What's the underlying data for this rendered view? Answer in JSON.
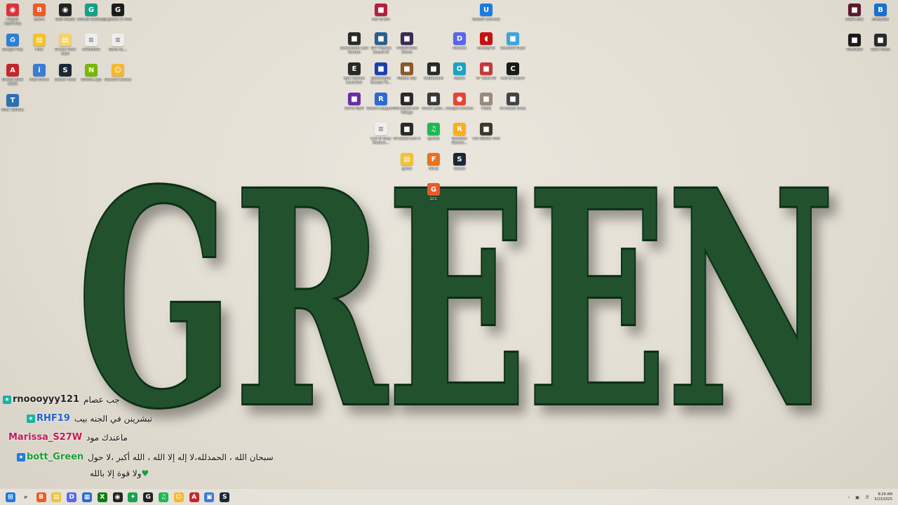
{
  "wallpaper": {
    "word": "GREEN",
    "color": "#21512e"
  },
  "desktop_icons": [
    {
      "label": "Project Lightning",
      "icon": "red-circle-icon",
      "color": "#d8343b"
    },
    {
      "label": "Brave",
      "icon": "brave-icon",
      "color": "#f05a24"
    },
    {
      "label": "OBS Studio",
      "icon": "obs-icon",
      "color": "#222222"
    },
    {
      "label": "GitHub Desktop",
      "icon": "github-icon",
      "color": "#16a085"
    },
    {
      "label": "Logitech G HUB",
      "icon": "logitech-icon",
      "color": "#1b1b1b"
    },
    {
      "label": "Google Play",
      "icon": "recycle-icon",
      "color": "#2c7fd1"
    },
    {
      "label": "Files",
      "icon": "folder-icon",
      "color": "#f2c230"
    },
    {
      "label": "Grand Theft Auto",
      "icon": "folder-icon",
      "color": "#f5d36a"
    },
    {
      "label": "DIVIDEWA",
      "icon": "document-icon",
      "color": "#eeeeee"
    },
    {
      "label": "NEUE EL...",
      "icon": "document-icon",
      "color": "#eeeeee"
    },
    {
      "label": "Dream Rock ASUS",
      "icon": "asus-icon",
      "color": "#c4262e"
    },
    {
      "label": "Intel Driver",
      "icon": "intel-icon",
      "color": "#3a7bd5"
    },
    {
      "label": "Steam Tools",
      "icon": "steam-icon",
      "color": "#1b2838"
    },
    {
      "label": "NVIDIA App",
      "icon": "nvidia-icon",
      "color": "#76b900"
    },
    {
      "label": "Discord Canary",
      "icon": "smiley-icon",
      "color": "#f5b82e"
    },
    {
      "label": "Mika Toolbox",
      "icon": "toolbox-icon",
      "color": "#2c6fb4"
    },
    {
      "label": "Nur El Din",
      "icon": "game-icon",
      "color": "#b3213b"
    },
    {
      "label": "Ubisoft Connect",
      "icon": "ubisoft-icon",
      "color": "#1f7ae0"
    },
    {
      "label": "Backrooms Lost Version",
      "icon": "game-icon",
      "color": "#2a2a2a"
    },
    {
      "label": "SPY Physics Sound of",
      "icon": "game-icon",
      "color": "#2b5f8c"
    },
    {
      "label": "FRONTSIDE Demo",
      "icon": "game-icon",
      "color": "#3b2a55"
    },
    {
      "label": "Discord",
      "icon": "discord-icon",
      "color": "#5865f2"
    },
    {
      "label": "Among Us",
      "icon": "amongus-icon",
      "color": "#c51111"
    },
    {
      "label": "Stumble Guys",
      "icon": "game-icon",
      "color": "#39a7e0"
    },
    {
      "label": "Epic Games Launcher",
      "icon": "epic-icon",
      "color": "#2a2a2a"
    },
    {
      "label": "Backrooms Escape To...",
      "icon": "game-icon",
      "color": "#1e3fae"
    },
    {
      "label": "Roblox Sky",
      "icon": "game-icon",
      "color": "#8a5a2b"
    },
    {
      "label": "DalBlueard",
      "icon": "game-icon",
      "color": "#2a2a2a"
    },
    {
      "label": "Opera",
      "icon": "opera-icon",
      "color": "#1aa3c7"
    },
    {
      "label": "FF Team DI",
      "icon": "game-icon",
      "color": "#c33a3a"
    },
    {
      "label": "Call of Duty®",
      "icon": "cod-icon",
      "color": "#1a1a1a"
    },
    {
      "label": "NOTE NEW",
      "icon": "game-icon",
      "color": "#6b2fa3"
    },
    {
      "label": "Rocket League®",
      "icon": "rocket-icon",
      "color": "#2a6bd1"
    },
    {
      "label": "Mr.Sweet Evil Village",
      "icon": "game-icon",
      "color": "#2a2a2a"
    },
    {
      "label": "Ghost Ledo...",
      "icon": "game-icon",
      "color": "#3a3a3a"
    },
    {
      "label": "Google Chrome",
      "icon": "chrome-icon",
      "color": "#ea4335"
    },
    {
      "label": "PUBG",
      "icon": "game-icon",
      "color": "#9a8a7a"
    },
    {
      "label": "Mr.Sweet Hoss",
      "icon": "game-icon",
      "color": "#444444"
    },
    {
      "label": "Call of Duty Modern...",
      "icon": "document-icon",
      "color": "#eeeeee"
    },
    {
      "label": "Mr.Sweet Evil 4",
      "icon": "game-icon",
      "color": "#2a2a2a"
    },
    {
      "label": "Spotify",
      "icon": "spotify-icon",
      "color": "#1db954"
    },
    {
      "label": "Rockstar Games...",
      "icon": "rockstar-icon",
      "color": "#fcaf17"
    },
    {
      "label": "The Walker Moh",
      "icon": "game-icon",
      "color": "#3d3a2a"
    },
    {
      "label": "game",
      "icon": "folder-icon",
      "color": "#f2c230"
    },
    {
      "label": "Fat32",
      "icon": "fat-icon",
      "color": "#e8731c"
    },
    {
      "label": "Steam",
      "icon": "steam-icon",
      "color": "#1b2838"
    },
    {
      "label": "GCC",
      "icon": "gcc-icon",
      "color": "#e85a2a"
    },
    {
      "label": "Dad's Boo",
      "icon": "game-icon",
      "color": "#5a1a2a"
    },
    {
      "label": "BitBucket",
      "icon": "bitbucket-icon",
      "color": "#1a6fd1"
    },
    {
      "label": "Dark Mode",
      "icon": "game-icon",
      "color": "#2a2a2a"
    },
    {
      "label": "ROBOKID",
      "icon": "game-icon",
      "color": "#1a1a1a"
    }
  ],
  "chat": [
    {
      "user": "rnoooyyy121",
      "user_color": "#222222",
      "message": "جب عصام",
      "badge_color": "#19b3a3"
    },
    {
      "user": "RHF19",
      "user_color": "#1f5fd1",
      "message": "تبشرينن في الجنه بيب",
      "badge_color": "#19b3a3"
    },
    {
      "user": "Marissa_S27W",
      "user_color": "#c2185b",
      "message": "ماعندك مود",
      "badge_color": ""
    },
    {
      "user": "bott_Green",
      "user_color": "#1c9c3a",
      "message": "سبحان الله ، الحمدلله،لا إله إلا الله ، الله أكبر ،لا حول",
      "badge_color": "#1f7ae0"
    },
    {
      "user": "",
      "user_color": "#1c9c3a",
      "message": "ولا قوة إلا بالله",
      "badge_color": ""
    }
  ],
  "taskbar": {
    "items": [
      {
        "name": "start-button",
        "icon": "windows-icon",
        "color": "#1f7ae0",
        "glyph": "⊞"
      },
      {
        "name": "search-button",
        "icon": "search-icon",
        "color": "#555555",
        "glyph": "⌕"
      },
      {
        "name": "brave-taskbar",
        "icon": "brave-icon",
        "color": "#f05a24",
        "glyph": "B"
      },
      {
        "name": "explorer-taskbar",
        "icon": "folder-icon",
        "color": "#f2c230",
        "glyph": "▤"
      },
      {
        "name": "discord-taskbar",
        "icon": "discord-icon",
        "color": "#5865f2",
        "glyph": "D"
      },
      {
        "name": "store-taskbar",
        "icon": "store-icon",
        "color": "#2a6bd1",
        "glyph": "▦"
      },
      {
        "name": "xbox-taskbar",
        "icon": "xbox-icon",
        "color": "#107c10",
        "glyph": "X"
      },
      {
        "name": "obs-taskbar",
        "icon": "obs-icon",
        "color": "#222222",
        "glyph": "◉"
      },
      {
        "name": "robot-taskbar",
        "icon": "game-icon",
        "color": "#19a34a",
        "glyph": "✦"
      },
      {
        "name": "github-taskbar",
        "icon": "github-icon",
        "color": "#222222",
        "glyph": "G"
      },
      {
        "name": "spotify-taskbar",
        "icon": "spotify-icon",
        "color": "#1db954",
        "glyph": "♫"
      },
      {
        "name": "discord-canary-taskbar",
        "icon": "smiley-icon",
        "color": "#f5b82e",
        "glyph": "☺"
      },
      {
        "name": "asus-taskbar",
        "icon": "asus-icon",
        "color": "#c4262e",
        "glyph": "A"
      },
      {
        "name": "window-taskbar",
        "icon": "window-icon",
        "color": "#3a7bd5",
        "glyph": "▣"
      },
      {
        "name": "steam-taskbar",
        "icon": "steam-icon",
        "color": "#1b2838",
        "glyph": "S"
      }
    ],
    "tray": {
      "chevron": "‹",
      "clock_time": "8:29 AM",
      "clock_date": "5/23/2025"
    }
  }
}
